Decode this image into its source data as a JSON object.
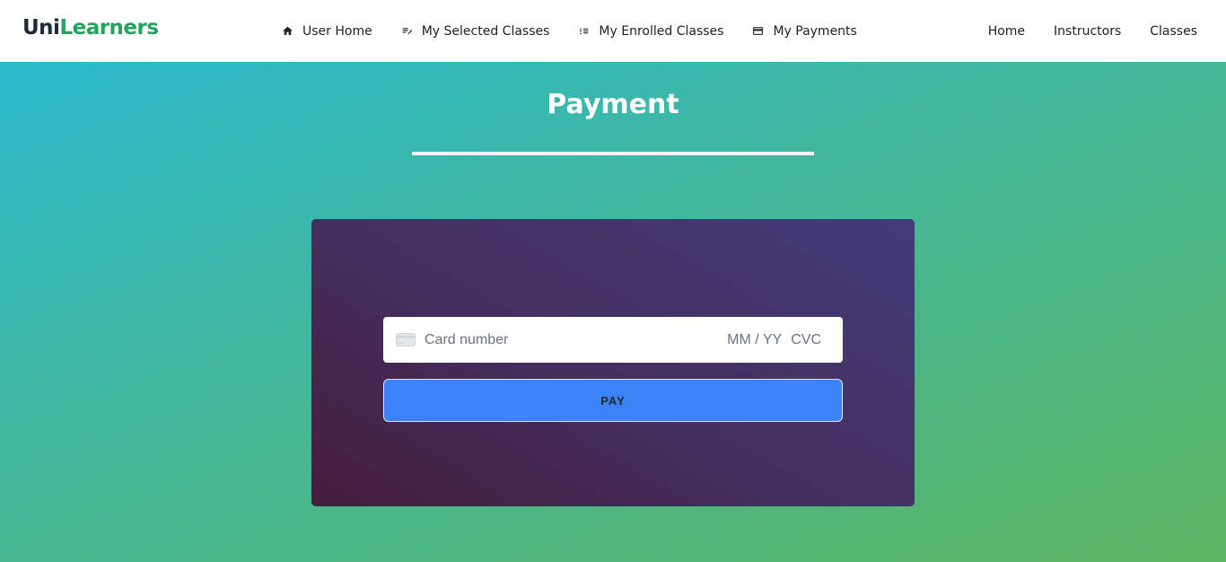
{
  "brand": {
    "prefix": "Uni",
    "suffix": "Learners",
    "accent_color": "#22a45d"
  },
  "dashboard_nav": [
    {
      "label": "User Home",
      "icon": "home-icon"
    },
    {
      "label": "My Selected Classes",
      "icon": "playlist-edit-icon"
    },
    {
      "label": "My Enrolled Classes",
      "icon": "checklist-icon"
    },
    {
      "label": "My Payments",
      "icon": "credit-card-icon"
    }
  ],
  "main_nav": [
    {
      "label": "Home"
    },
    {
      "label": "Instructors"
    },
    {
      "label": "Classes"
    }
  ],
  "page": {
    "title": "Payment"
  },
  "payment_form": {
    "card_number_placeholder": "Card number",
    "expiry_placeholder": "MM / YY",
    "cvc_placeholder": "CVC",
    "pay_label": "PAY",
    "button_color": "#3b82f6"
  }
}
